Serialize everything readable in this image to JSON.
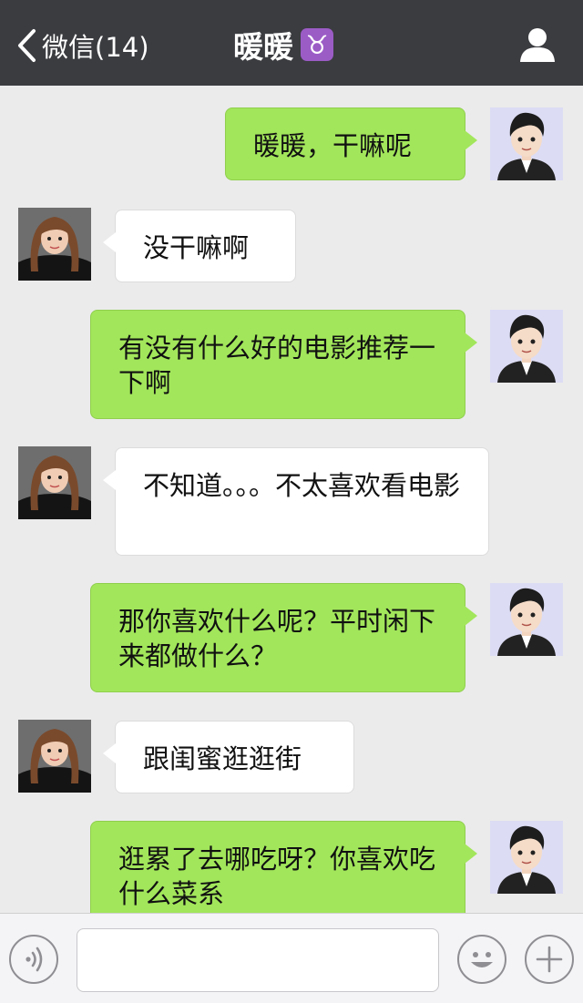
{
  "header": {
    "back_label": "微信(14)",
    "title": "暖暖",
    "zodiac_symbol": "♉"
  },
  "icons": {
    "back": "chevron-left-icon",
    "zodiac": "taurus-icon",
    "profile": "person-icon",
    "voice": "voice-icon",
    "emoji": "emoji-icon",
    "more": "plus-icon"
  },
  "messages": [
    {
      "from": "me",
      "text": "暖暖，干嘛呢"
    },
    {
      "from": "her",
      "text": "没干嘛啊"
    },
    {
      "from": "me",
      "text": "有没有什么好的电影推荐一下啊"
    },
    {
      "from": "her",
      "text": "不知道。。。不太喜欢看电影"
    },
    {
      "from": "me",
      "text": "那你喜欢什么呢？平时闲下来都做什么？"
    },
    {
      "from": "her",
      "text": "跟闺蜜逛逛街"
    },
    {
      "from": "me",
      "text": "逛累了去哪吃呀？你喜欢吃什么菜系"
    }
  ],
  "input": {
    "value": "",
    "placeholder": ""
  },
  "colors": {
    "nav_bg": "#3b3c40",
    "chat_bg": "#ebebeb",
    "outgoing_bubble": "#a2e65b",
    "incoming_bubble": "#ffffff",
    "zodiac_badge": "#9b5cc6"
  }
}
